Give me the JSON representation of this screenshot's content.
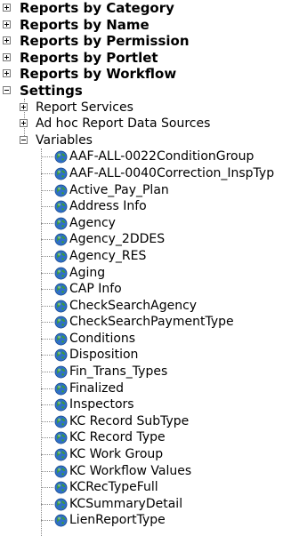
{
  "top_items": [
    {
      "label": "Reports by Category",
      "state": "collapsed"
    },
    {
      "label": "Reports by Name",
      "state": "collapsed"
    },
    {
      "label": "Reports by Permission",
      "state": "collapsed"
    },
    {
      "label": "Reports by Portlet",
      "state": "collapsed"
    },
    {
      "label": "Reports by Workflow",
      "state": "collapsed"
    },
    {
      "label": "Settings",
      "state": "expanded"
    }
  ],
  "settings_children": [
    {
      "label": "Report Services",
      "state": "collapsed"
    },
    {
      "label": "Ad hoc Report Data Sources",
      "state": "collapsed"
    },
    {
      "label": "Variables",
      "state": "expanded"
    }
  ],
  "variables": [
    "AAF-ALL-0022ConditionGroup",
    "AAF-ALL-0040Correction_InspTyp",
    "Active_Pay_Plan",
    "Address Info",
    "Agency",
    "Agency_2DDES",
    "Agency_RES",
    "Aging",
    "CAP Info",
    "CheckSearchAgency",
    "CheckSearchPaymentType",
    "Conditions",
    "Disposition",
    "Fin_Trans_Types",
    "Finalized",
    "Inspectors",
    "KC Record SubType",
    "KC Record Type",
    "KC Work Group",
    "KC Workflow Values",
    "KCRecTypeFull",
    "KCSummaryDetail",
    "LienReportType"
  ],
  "icon": "globe-icon",
  "colors": {
    "globe_blue": "#2f6fc8",
    "globe_green": "#3a9a3a",
    "line": "#888888"
  }
}
